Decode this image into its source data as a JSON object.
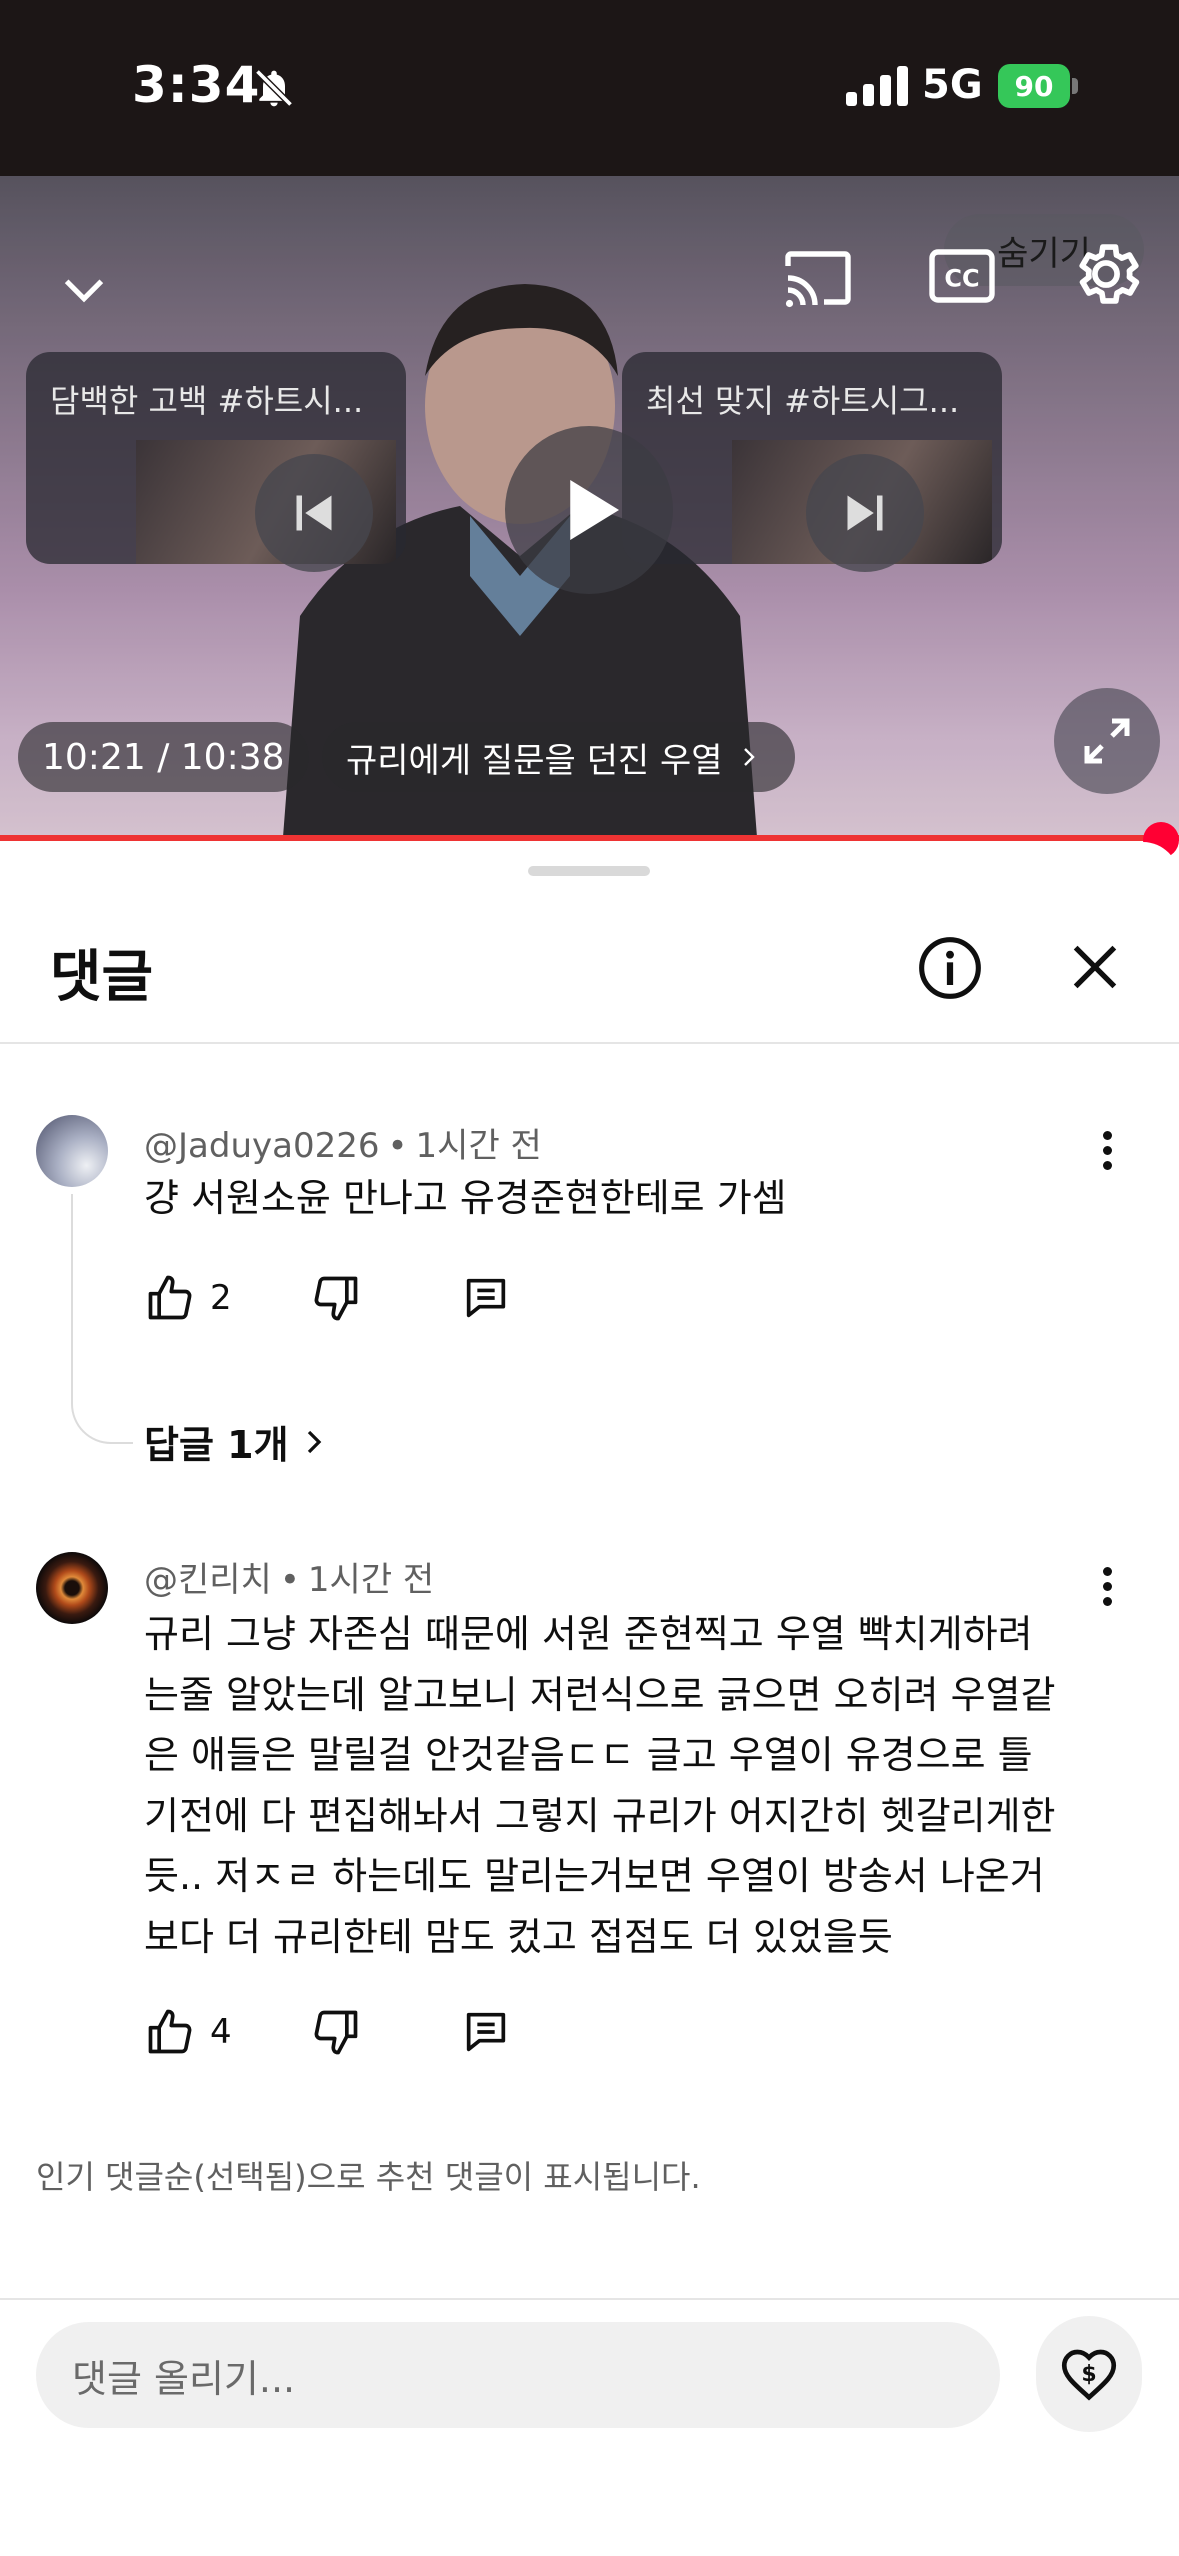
{
  "status_bar": {
    "time": "3:34",
    "network": "5G",
    "battery": "90"
  },
  "player": {
    "prev_video_title": "담백한 고백 #하트시...",
    "next_video_title": "최선 맞지 #하트시그...",
    "time_display": "10:21 / 10:38",
    "chapter_title": "규리에게 질문을 던진 우열",
    "autoplay_label": "숨기기",
    "progress": 0.987
  },
  "comments_panel": {
    "title": "댓글",
    "comments": [
      {
        "author": "@Jaduya0226",
        "time": "1시간 전",
        "text": "걍 서원소윤 만나고 유경준현한테로 가셈",
        "likes": "2",
        "replies_label": "답글 1개"
      },
      {
        "author": "@킨리치",
        "time": "1시간 전",
        "text_lines": [
          "규리 그냥 자존심 때문에 서원 준현찍고 우열 빡치게하려",
          "는줄 알았는데 알고보니 저런식으로 긁으면 오히려 우열같",
          "은 애들은 말릴걸 안것같음ㄷㄷ 글고 우열이 유경으로 틀",
          "기전에 다 편집해놔서 그렇지 규리가 어지간히 헷갈리게한",
          "듯.. 저ㅈㄹ 하는데도 말리는거보면 우열이 방송서 나온거",
          "보다 더 규리한테 맘도 컸고 접점도 더 있었을듯"
        ],
        "likes": "4"
      }
    ],
    "sort_note": "인기 댓글순(선택됨)으로 추천 댓글이 표시됩니다.",
    "composer_placeholder": "댓글 올리기..."
  },
  "colors": {
    "status_bg": "#1c1616",
    "progress": "#ff0033",
    "battery": "#35c759",
    "secondary_text": "#606060"
  },
  "icons": [
    "bell-off-icon",
    "chevron-down-icon",
    "cast-icon",
    "cc-icon",
    "gear-icon",
    "skip-previous-icon",
    "play-icon",
    "skip-next-icon",
    "fullscreen-icon",
    "chevron-right-icon",
    "info-icon",
    "close-icon",
    "more-vert-icon",
    "thumb-up-icon",
    "thumb-down-icon",
    "reply-icon",
    "super-thanks-icon"
  ]
}
